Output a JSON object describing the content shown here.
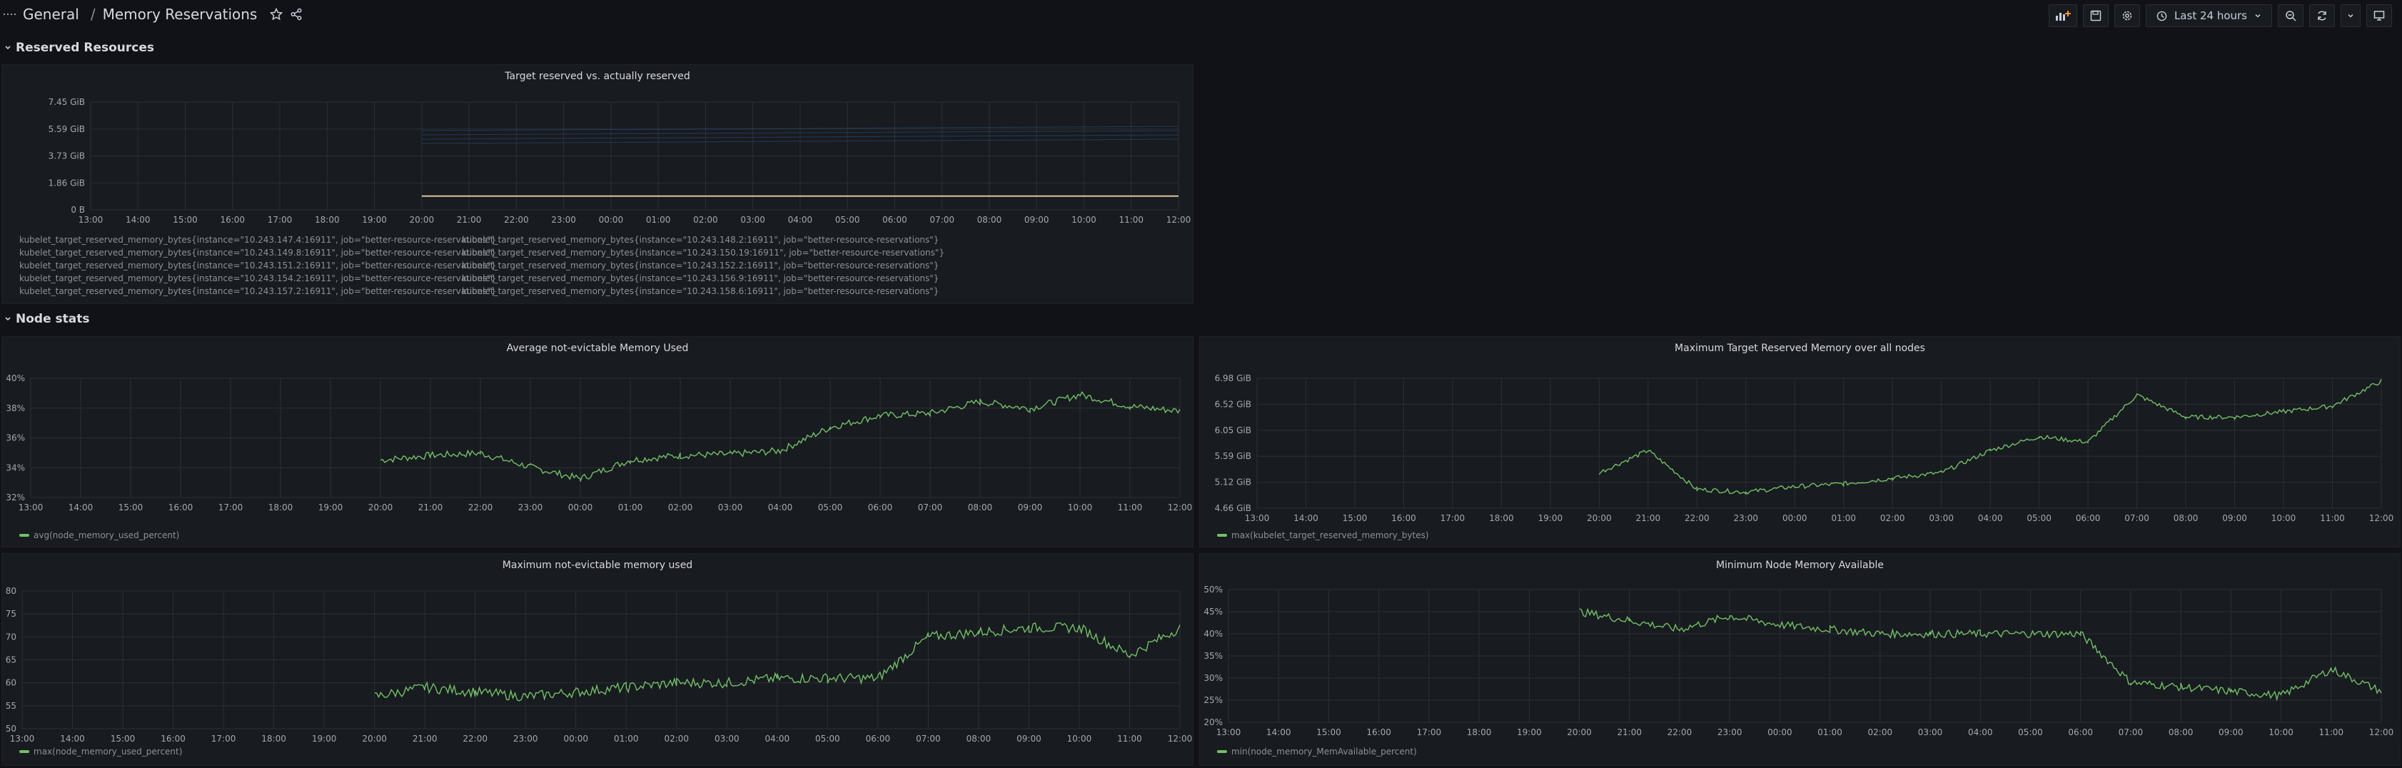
{
  "header": {
    "folder": "General",
    "separator": "/",
    "title": "Memory Reservations",
    "time_range": "Last 24 hours"
  },
  "rows": [
    {
      "title": "Reserved Resources"
    },
    {
      "title": "Node stats"
    }
  ],
  "colors": {
    "series": "#73bf69",
    "grid": "#2c2f35",
    "accent": "#3d71d9"
  },
  "panels": {
    "target_reserved": {
      "title": "Target reserved vs. actually reserved",
      "legend": [
        "kubelet_target_reserved_memory_bytes{instance=\"10.243.147.4:16911\", job=\"better-resource-reservations\"}",
        "kubelet_target_reserved_memory_bytes{instance=\"10.243.148.2:16911\", job=\"better-resource-reservations\"}",
        "kubelet_target_reserved_memory_bytes{instance=\"10.243.149.8:16911\", job=\"better-resource-reservations\"}",
        "kubelet_target_reserved_memory_bytes{instance=\"10.243.150.19:16911\", job=\"better-resource-reservations\"}",
        "kubelet_target_reserved_memory_bytes{instance=\"10.243.151.2:16911\", job=\"better-resource-reservations\"}",
        "kubelet_target_reserved_memory_bytes{instance=\"10.243.152.2:16911\", job=\"better-resource-reservations\"}",
        "kubelet_target_reserved_memory_bytes{instance=\"10.243.154.2:16911\", job=\"better-resource-reservations\"}",
        "kubelet_target_reserved_memory_bytes{instance=\"10.243.156.9:16911\", job=\"better-resource-reservations\"}",
        "kubelet_target_reserved_memory_bytes{instance=\"10.243.157.2:16911\", job=\"better-resource-reservations\"}",
        "kubelet_target_reserved_memory_bytes{instance=\"10.243.158.6:16911\", job=\"better-resource-reservations\"}"
      ],
      "legend_colors": [
        "#5a5a5a",
        "#2f4a6b",
        "#e0e0e0",
        "#f0f0f0",
        "#e0e0e0",
        "#d0d0d0",
        "#e0e0e0",
        "#dddddd",
        "#e0e0e0",
        "#ffffff"
      ]
    },
    "avg_used": {
      "title": "Average not-evictable Memory Used",
      "legend": "avg(node_memory_used_percent)"
    },
    "max_target": {
      "title": "Maximum Target Reserved Memory over all nodes",
      "legend": "max(kubelet_target_reserved_memory_bytes)"
    },
    "max_used": {
      "title": "Maximum not-evictable memory used",
      "legend": "max(node_memory_used_percent)"
    },
    "min_available": {
      "title": "Minimum Node Memory Available",
      "legend": "min(node_memory_MemAvailable_percent)"
    }
  },
  "chart_data": [
    {
      "type": "line",
      "title": "Target reserved vs. actually reserved",
      "x": [
        "13:00",
        "14:00",
        "15:00",
        "16:00",
        "17:00",
        "18:00",
        "19:00",
        "20:00",
        "21:00",
        "22:00",
        "23:00",
        "00:00",
        "01:00",
        "02:00",
        "03:00",
        "04:00",
        "05:00",
        "06:00",
        "07:00",
        "08:00",
        "09:00",
        "10:00",
        "11:00",
        "12:00"
      ],
      "yticks": [
        "0 B",
        "1.86 GiB",
        "3.73 GiB",
        "5.59 GiB",
        "7.45 GiB"
      ],
      "ylim": [
        0,
        7.45
      ],
      "series": [
        {
          "values": [
            null,
            null,
            null,
            null,
            null,
            null,
            null,
            0.95,
            0.95,
            0.95,
            0.95,
            0.95,
            0.95,
            0.95,
            0.95,
            0.95,
            0.95,
            0.95,
            0.95,
            0.95,
            0.95,
            0.95,
            0.95,
            0.95
          ]
        }
      ]
    },
    {
      "type": "line",
      "title": "Average not-evictable Memory Used",
      "x": [
        "13:00",
        "14:00",
        "15:00",
        "16:00",
        "17:00",
        "18:00",
        "19:00",
        "20:00",
        "21:00",
        "22:00",
        "23:00",
        "00:00",
        "01:00",
        "02:00",
        "03:00",
        "04:00",
        "05:00",
        "06:00",
        "07:00",
        "08:00",
        "09:00",
        "10:00",
        "11:00",
        "12:00"
      ],
      "yticks": [
        "32%",
        "34%",
        "36%",
        "38%",
        "40%"
      ],
      "ylim": [
        31,
        41.2
      ],
      "series": [
        {
          "name": "avg(node_memory_used_percent)",
          "values": [
            null,
            null,
            null,
            null,
            null,
            null,
            null,
            34.2,
            34.6,
            34.8,
            33.6,
            32.6,
            34.2,
            34.6,
            34.7,
            35.0,
            37.0,
            38.0,
            38.2,
            39.2,
            38.6,
            39.8,
            38.8,
            38.4
          ]
        }
      ]
    },
    {
      "type": "line",
      "title": "Maximum Target Reserved Memory over all nodes",
      "x": [
        "13:00",
        "14:00",
        "15:00",
        "16:00",
        "17:00",
        "18:00",
        "19:00",
        "20:00",
        "21:00",
        "22:00",
        "23:00",
        "00:00",
        "01:00",
        "02:00",
        "03:00",
        "04:00",
        "05:00",
        "06:00",
        "07:00",
        "08:00",
        "09:00",
        "10:00",
        "11:00",
        "12:00"
      ],
      "yticks": [
        "4.66 GiB",
        "5.12 GiB",
        "5.59 GiB",
        "6.05 GiB",
        "6.52 GiB",
        "6.98 GiB"
      ],
      "ylim": [
        4.66,
        7.0
      ],
      "series": [
        {
          "name": "max(kubelet_target_reserved_memory_bytes)",
          "values": [
            null,
            null,
            null,
            null,
            null,
            null,
            null,
            5.3,
            5.7,
            5.0,
            4.95,
            5.05,
            5.1,
            5.2,
            5.3,
            5.7,
            5.95,
            5.85,
            6.7,
            6.3,
            6.3,
            6.4,
            6.5,
            6.95
          ]
        }
      ]
    },
    {
      "type": "line",
      "title": "Maximum not-evictable memory used",
      "x": [
        "13:00",
        "14:00",
        "15:00",
        "16:00",
        "17:00",
        "18:00",
        "19:00",
        "20:00",
        "21:00",
        "22:00",
        "23:00",
        "00:00",
        "01:00",
        "02:00",
        "03:00",
        "04:00",
        "05:00",
        "06:00",
        "07:00",
        "08:00",
        "09:00",
        "10:00",
        "11:00",
        "12:00"
      ],
      "yticks": [
        "50",
        "55",
        "60",
        "65",
        "70",
        "75",
        "80"
      ],
      "ylim": [
        50,
        80
      ],
      "series": [
        {
          "name": "max(node_memory_used_percent)",
          "values": [
            null,
            null,
            null,
            null,
            null,
            null,
            null,
            57,
            59,
            58,
            57,
            58,
            59,
            60,
            60,
            61,
            61,
            61,
            70,
            71,
            72,
            72,
            66,
            72
          ]
        }
      ]
    },
    {
      "type": "line",
      "title": "Minimum Node Memory Available",
      "x": [
        "13:00",
        "14:00",
        "15:00",
        "16:00",
        "17:00",
        "18:00",
        "19:00",
        "20:00",
        "21:00",
        "22:00",
        "23:00",
        "00:00",
        "01:00",
        "02:00",
        "03:00",
        "04:00",
        "05:00",
        "06:00",
        "07:00",
        "08:00",
        "09:00",
        "10:00",
        "11:00",
        "12:00"
      ],
      "yticks": [
        "20%",
        "25%",
        "30%",
        "35%",
        "40%",
        "45%",
        "50%"
      ],
      "ylim": [
        20,
        50
      ],
      "series": [
        {
          "name": "min(node_memory_MemAvailable_percent)",
          "values": [
            null,
            null,
            null,
            null,
            null,
            null,
            null,
            45,
            43,
            41,
            44,
            42,
            41,
            40,
            40,
            40,
            40,
            40,
            29,
            28,
            27,
            26,
            32,
            27
          ]
        }
      ]
    }
  ]
}
